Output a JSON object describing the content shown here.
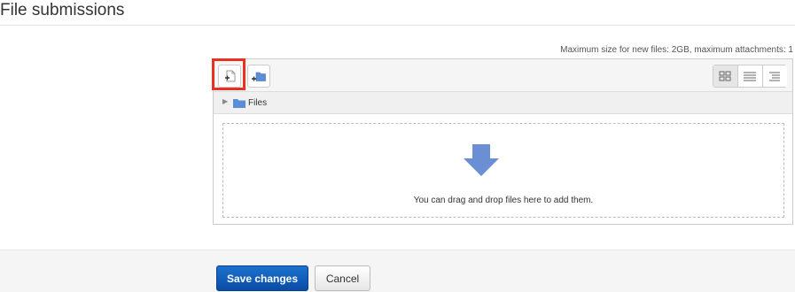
{
  "section": {
    "title": "File submissions"
  },
  "filemanager": {
    "max_info": "Maximum size for new files: 2GB, maximum attachments: 1",
    "path_label": "Files",
    "drop_text": "You can drag and drop files here to add them.",
    "icons": [
      "add-file-icon",
      "create-folder-icon",
      "icons-view-icon",
      "list-view-icon",
      "tree-view-icon",
      "folder-icon",
      "drop-arrow-icon"
    ]
  },
  "footer": {
    "save_label": "Save changes",
    "cancel_label": "Cancel"
  },
  "colors": {
    "save_button": "#0a4ba5",
    "highlight": "#e8321f",
    "folder": "#5b8ed6",
    "drop_arrow": "#6b8fd4"
  }
}
